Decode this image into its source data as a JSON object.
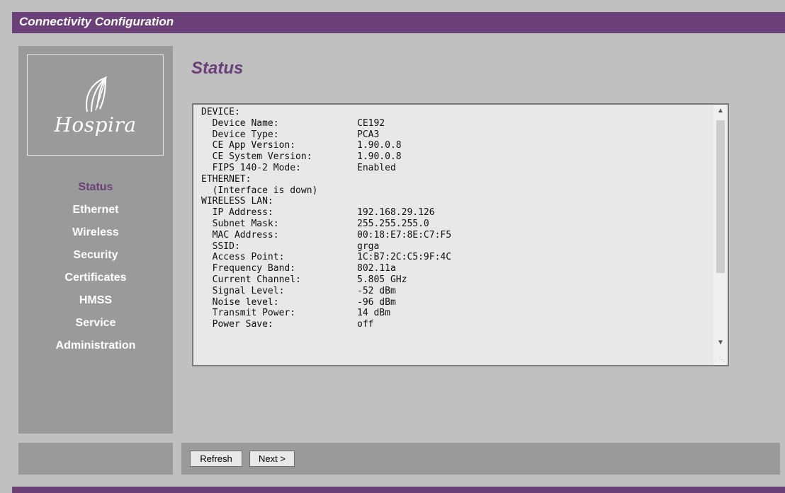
{
  "app": {
    "title": "Connectivity Configuration",
    "brand": "Hospira",
    "accent_color": "#6b3f78"
  },
  "sidebar": {
    "logo_icon": "hospira-leaf-logo",
    "items": [
      {
        "label": "Status",
        "active": true
      },
      {
        "label": "Ethernet",
        "active": false
      },
      {
        "label": "Wireless",
        "active": false
      },
      {
        "label": "Security",
        "active": false
      },
      {
        "label": "Certificates",
        "active": false
      },
      {
        "label": "HMSS",
        "active": false
      },
      {
        "label": "Service",
        "active": false
      },
      {
        "label": "Administration",
        "active": false
      }
    ]
  },
  "main": {
    "title": "Status",
    "status_lines": [
      {
        "key": "DEVICE:",
        "value": ""
      },
      {
        "key": "  Device Name:",
        "value": "CE192"
      },
      {
        "key": "  Device Type:",
        "value": "PCA3"
      },
      {
        "key": "  CE App Version:",
        "value": "1.90.0.8"
      },
      {
        "key": "  CE System Version:",
        "value": "1.90.0.8"
      },
      {
        "key": "  FIPS 140-2 Mode:",
        "value": "Enabled"
      },
      {
        "key": "ETHERNET:",
        "value": ""
      },
      {
        "key": "  (Interface is down)",
        "value": ""
      },
      {
        "key": "WIRELESS LAN:",
        "value": ""
      },
      {
        "key": "  IP Address:",
        "value": "192.168.29.126"
      },
      {
        "key": "  Subnet Mask:",
        "value": "255.255.255.0"
      },
      {
        "key": "  MAC Address:",
        "value": "00:18:E7:8E:C7:F5"
      },
      {
        "key": "  SSID:",
        "value": "grga"
      },
      {
        "key": "  Access Point:",
        "value": "1C:B7:2C:C5:9F:4C"
      },
      {
        "key": "  Frequency Band:",
        "value": "802.11a"
      },
      {
        "key": "  Current Channel:",
        "value": "5.805 GHz"
      },
      {
        "key": "  Signal Level:",
        "value": "-52 dBm"
      },
      {
        "key": "  Noise level:",
        "value": "-96 dBm"
      },
      {
        "key": "  Transmit Power:",
        "value": "14 dBm"
      },
      {
        "key": "  Power Save:",
        "value": "off"
      }
    ]
  },
  "footer": {
    "refresh_label": "Refresh",
    "next_label": "Next >"
  }
}
